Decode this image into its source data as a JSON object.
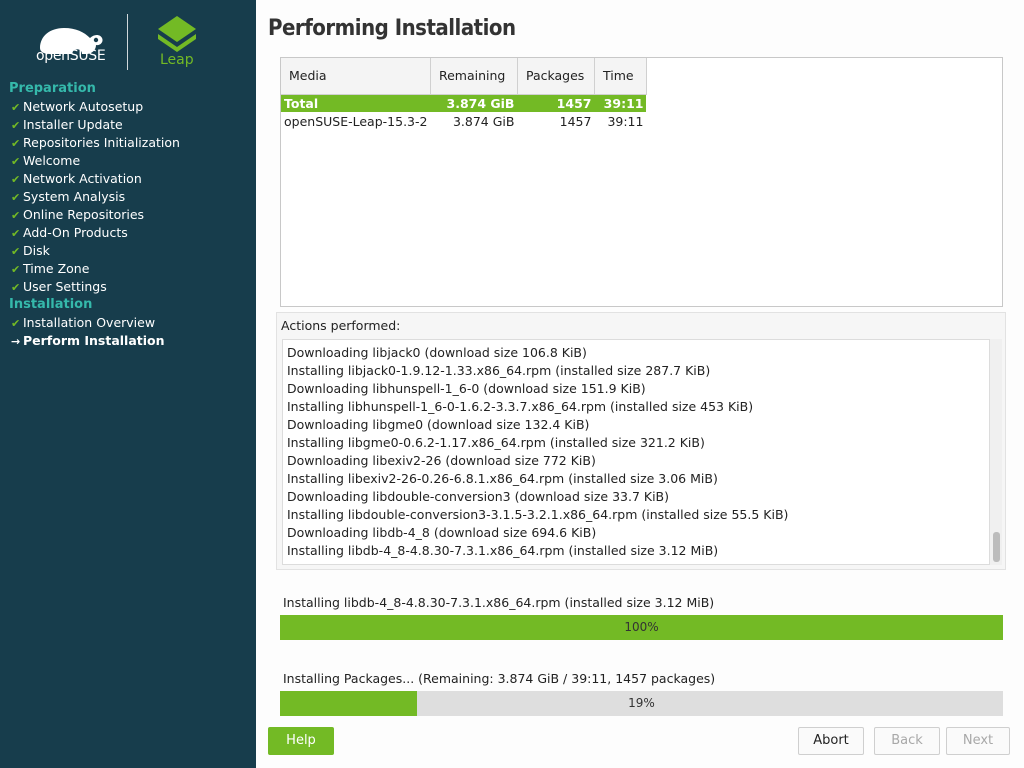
{
  "sidebar": {
    "brand": "openSUSE",
    "product": "Leap",
    "groups": [
      {
        "heading": "Preparation",
        "steps": [
          {
            "label": "Network Autosetup",
            "mark": "✔"
          },
          {
            "label": "Installer Update",
            "mark": "✔"
          },
          {
            "label": "Repositories Initialization",
            "mark": "✔"
          },
          {
            "label": "Welcome",
            "mark": "✔"
          },
          {
            "label": "Network Activation",
            "mark": "✔"
          },
          {
            "label": "System Analysis",
            "mark": "✔"
          },
          {
            "label": "Online Repositories",
            "mark": "✔"
          },
          {
            "label": "Add-On Products",
            "mark": "✔"
          },
          {
            "label": "Disk",
            "mark": "✔"
          },
          {
            "label": "Time Zone",
            "mark": "✔"
          },
          {
            "label": "User Settings",
            "mark": "✔"
          }
        ]
      },
      {
        "heading": "Installation",
        "steps": [
          {
            "label": "Installation Overview",
            "mark": "✔"
          },
          {
            "label": "Perform Installation",
            "mark": "→",
            "current": true
          }
        ]
      }
    ]
  },
  "title": "Performing Installation",
  "media_table": {
    "columns": [
      "Media",
      "Remaining",
      "Packages",
      "Time"
    ],
    "rows": [
      {
        "media": "Total",
        "remaining": "3.874 GiB",
        "packages": "1457",
        "time": "39:11",
        "selected": true
      },
      {
        "media": "openSUSE-Leap-15.3-2",
        "remaining": "3.874 GiB",
        "packages": "1457",
        "time": "39:11"
      }
    ]
  },
  "actions": {
    "label": "Actions performed:",
    "lines": [
      "Downloading libjack0 (download size 106.8 KiB)",
      "Installing libjack0-1.9.12-1.33.x86_64.rpm (installed size 287.7 KiB)",
      "Downloading libhunspell-1_6-0 (download size 151.9 KiB)",
      "Installing libhunspell-1_6-0-1.6.2-3.3.7.x86_64.rpm (installed size 453 KiB)",
      "Downloading libgme0 (download size 132.4 KiB)",
      "Installing libgme0-0.6.2-1.17.x86_64.rpm (installed size 321.2 KiB)",
      "Downloading libexiv2-26 (download size 772 KiB)",
      "Installing libexiv2-26-0.26-6.8.1.x86_64.rpm (installed size 3.06 MiB)",
      "Downloading libdouble-conversion3 (download size 33.7 KiB)",
      "Installing libdouble-conversion3-3.1.5-3.2.1.x86_64.rpm (installed size 55.5 KiB)",
      "Downloading libdb-4_8 (download size 694.6 KiB)",
      "Installing libdb-4_8-4.8.30-7.3.1.x86_64.rpm (installed size 3.12 MiB)"
    ]
  },
  "progress_current": {
    "label": "Installing libdb-4_8-4.8.30-7.3.1.x86_64.rpm (installed size 3.12 MiB)",
    "percent": 100,
    "text": "100%"
  },
  "progress_total": {
    "label": "Installing Packages... (Remaining: 3.874 GiB / 39:11, 1457 packages)",
    "percent": 19,
    "text": "19%"
  },
  "buttons": {
    "help": "Help",
    "abort": "Abort",
    "back": "Back",
    "next": "Next"
  },
  "colors": {
    "sidebar_bg": "#173d4c",
    "accent_green": "#73ba25",
    "heading_teal": "#35b9ab"
  }
}
